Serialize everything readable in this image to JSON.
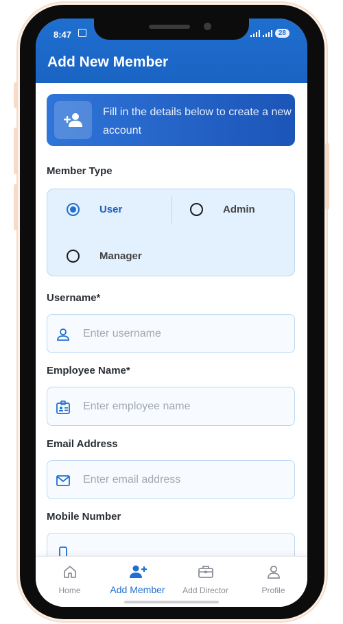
{
  "status_bar": {
    "time": "8:47",
    "battery": "28"
  },
  "header": {
    "title": "Add New Member"
  },
  "banner": {
    "text": "Fill in the details below to create a new account"
  },
  "member_type": {
    "label": "Member Type",
    "options": [
      "User",
      "Admin",
      "Manager"
    ],
    "selected": "User"
  },
  "fields": {
    "username": {
      "label": "Username*",
      "placeholder": "Enter username",
      "icon": "person-icon"
    },
    "employee_name": {
      "label": "Employee Name*",
      "placeholder": "Enter employee name",
      "icon": "id-badge-icon"
    },
    "email": {
      "label": "Email Address",
      "placeholder": "Enter email address",
      "icon": "mail-icon"
    },
    "mobile": {
      "label": "Mobile Number"
    }
  },
  "nav": {
    "items": [
      {
        "label": "Home",
        "icon": "home-icon"
      },
      {
        "label": "Add Member",
        "icon": "add-person-icon"
      },
      {
        "label": "Add Director",
        "icon": "briefcase-icon"
      },
      {
        "label": "Profile",
        "icon": "profile-icon"
      }
    ],
    "active": "Add Member"
  },
  "colors": {
    "primary": "#1f6fd0",
    "field_border": "#bcd7f3",
    "type_bg": "#e3f0fd"
  }
}
